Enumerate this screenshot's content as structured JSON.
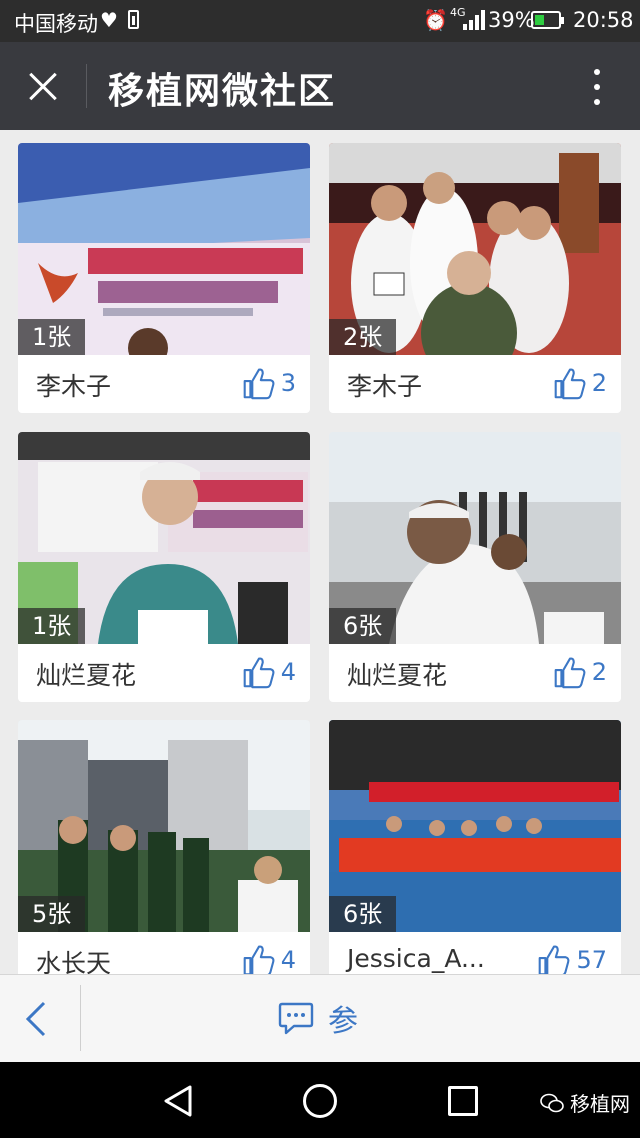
{
  "status_bar": {
    "carrier": "中国移动",
    "network": "4G",
    "battery_percent": "39%",
    "time": "20:58",
    "icons": [
      "heart-icon",
      "battery-small-icon",
      "alarm-icon",
      "signal-icon",
      "battery-icon"
    ]
  },
  "header": {
    "title": "移植网微社区",
    "close_icon": "close-icon",
    "more_icon": "more-vertical-icon"
  },
  "posts": [
    {
      "photo_count": "1张",
      "author": "李木子",
      "likes": "3"
    },
    {
      "photo_count": "2张",
      "author": "李木子",
      "likes": "2"
    },
    {
      "photo_count": "1张",
      "author": "灿烂夏花",
      "likes": "4"
    },
    {
      "photo_count": "6张",
      "author": "灿烂夏花",
      "likes": "2"
    },
    {
      "photo_count": "5张",
      "author": "水长天",
      "likes": "4"
    },
    {
      "photo_count": "6张",
      "author": "Jessica_A...",
      "likes": "57"
    }
  ],
  "toolbar": {
    "comment_label": "参",
    "back_icon": "chevron-left-icon",
    "comment_icon": "comment-icon"
  },
  "nav": {
    "watermark": "移植网"
  },
  "colors": {
    "header_bg": "#393a3f",
    "accent": "#3c77c5",
    "status_bg": "#2d2d2d"
  }
}
